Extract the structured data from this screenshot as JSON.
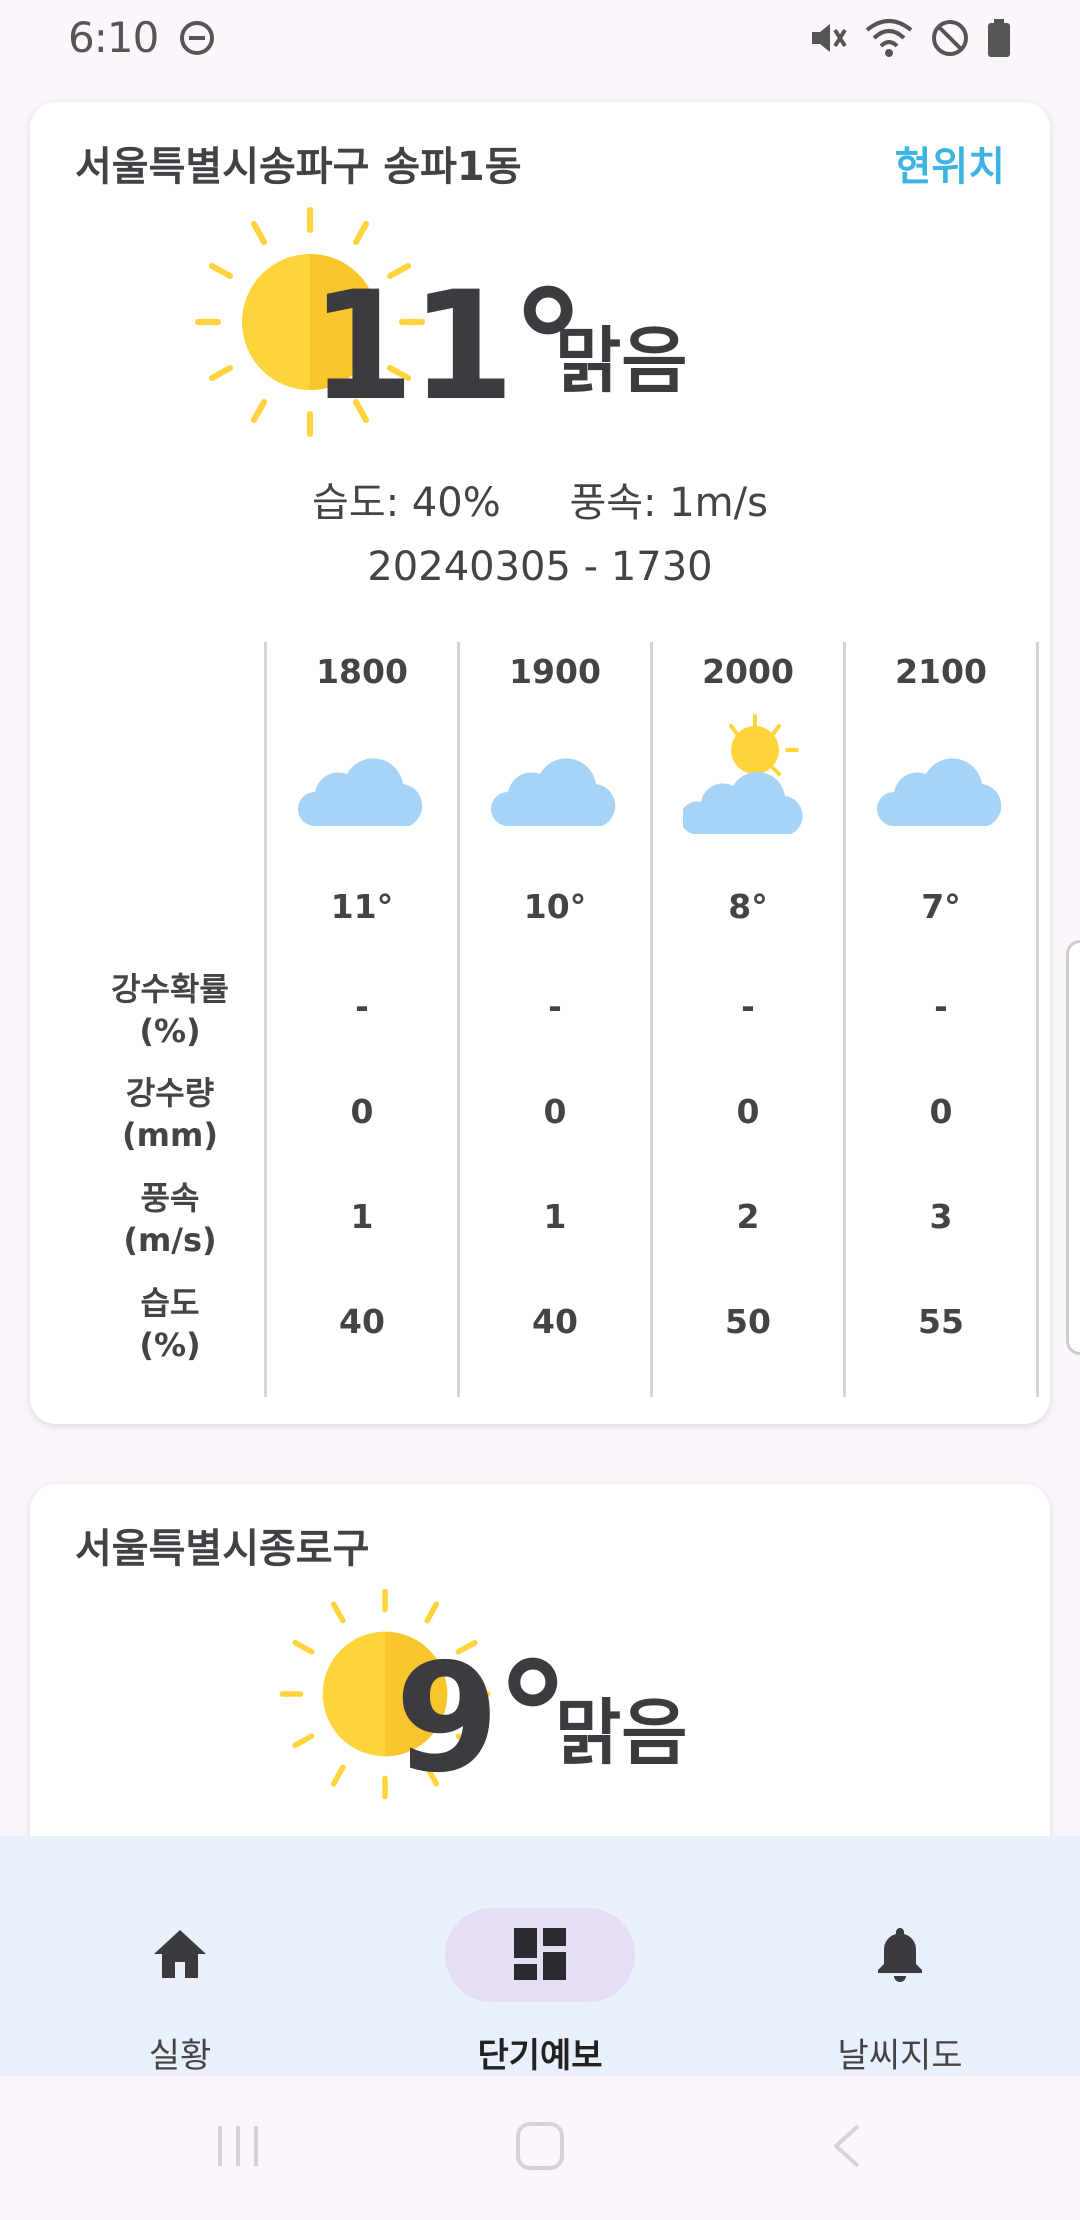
{
  "status_bar": {
    "time": "6:10",
    "icons": [
      "dnd-icon",
      "mute-icon",
      "wifi-icon",
      "blocked-icon",
      "battery-icon"
    ]
  },
  "current_card": {
    "location": "서울특별시송파구 송파1동",
    "current_location_label": "현위치",
    "temperature": "11°",
    "condition": "맑음",
    "humidity": "습도: 40%",
    "wind": "풍속: 1m/s",
    "timestamp": "20240305 - 1730",
    "icon": "sun-icon",
    "row_labels": [
      {
        "line1": "강수확률",
        "line2": "(%)"
      },
      {
        "line1": "강수량",
        "line2": "(mm)"
      },
      {
        "line1": "풍속",
        "line2": "(m/s)"
      },
      {
        "line1": "습도",
        "line2": "(%)"
      }
    ],
    "hours": [
      {
        "time": "1800",
        "icon": "cloud-icon",
        "temp": "11°",
        "precip_prob": "-",
        "precip": "0",
        "wind": "1",
        "humidity": "40"
      },
      {
        "time": "1900",
        "icon": "cloud-icon",
        "temp": "10°",
        "precip_prob": "-",
        "precip": "0",
        "wind": "1",
        "humidity": "40"
      },
      {
        "time": "2000",
        "icon": "partly-cloudy-icon",
        "temp": "8°",
        "precip_prob": "-",
        "precip": "0",
        "wind": "2",
        "humidity": "50"
      },
      {
        "time": "2100",
        "icon": "cloud-icon",
        "temp": "7°",
        "precip_prob": "-",
        "precip": "0",
        "wind": "3",
        "humidity": "55"
      }
    ]
  },
  "second_card": {
    "location": "서울특별시종로구",
    "temperature": "9°",
    "condition": "맑음",
    "icon": "sun-icon"
  },
  "bottom_nav": {
    "items": [
      {
        "label": "실황",
        "icon": "home-icon",
        "active": false
      },
      {
        "label": "단기예보",
        "icon": "dashboard-icon",
        "active": true
      },
      {
        "label": "날씨지도",
        "icon": "bell-icon",
        "active": false
      }
    ]
  },
  "colors": {
    "background": "#FCF5FC",
    "accent_link": "#3DB3E3",
    "nav_background": "#E9EFFB",
    "active_pill": "#E5DDF4",
    "sun": "#FFD43B",
    "cloud": "#A6D3F6"
  }
}
